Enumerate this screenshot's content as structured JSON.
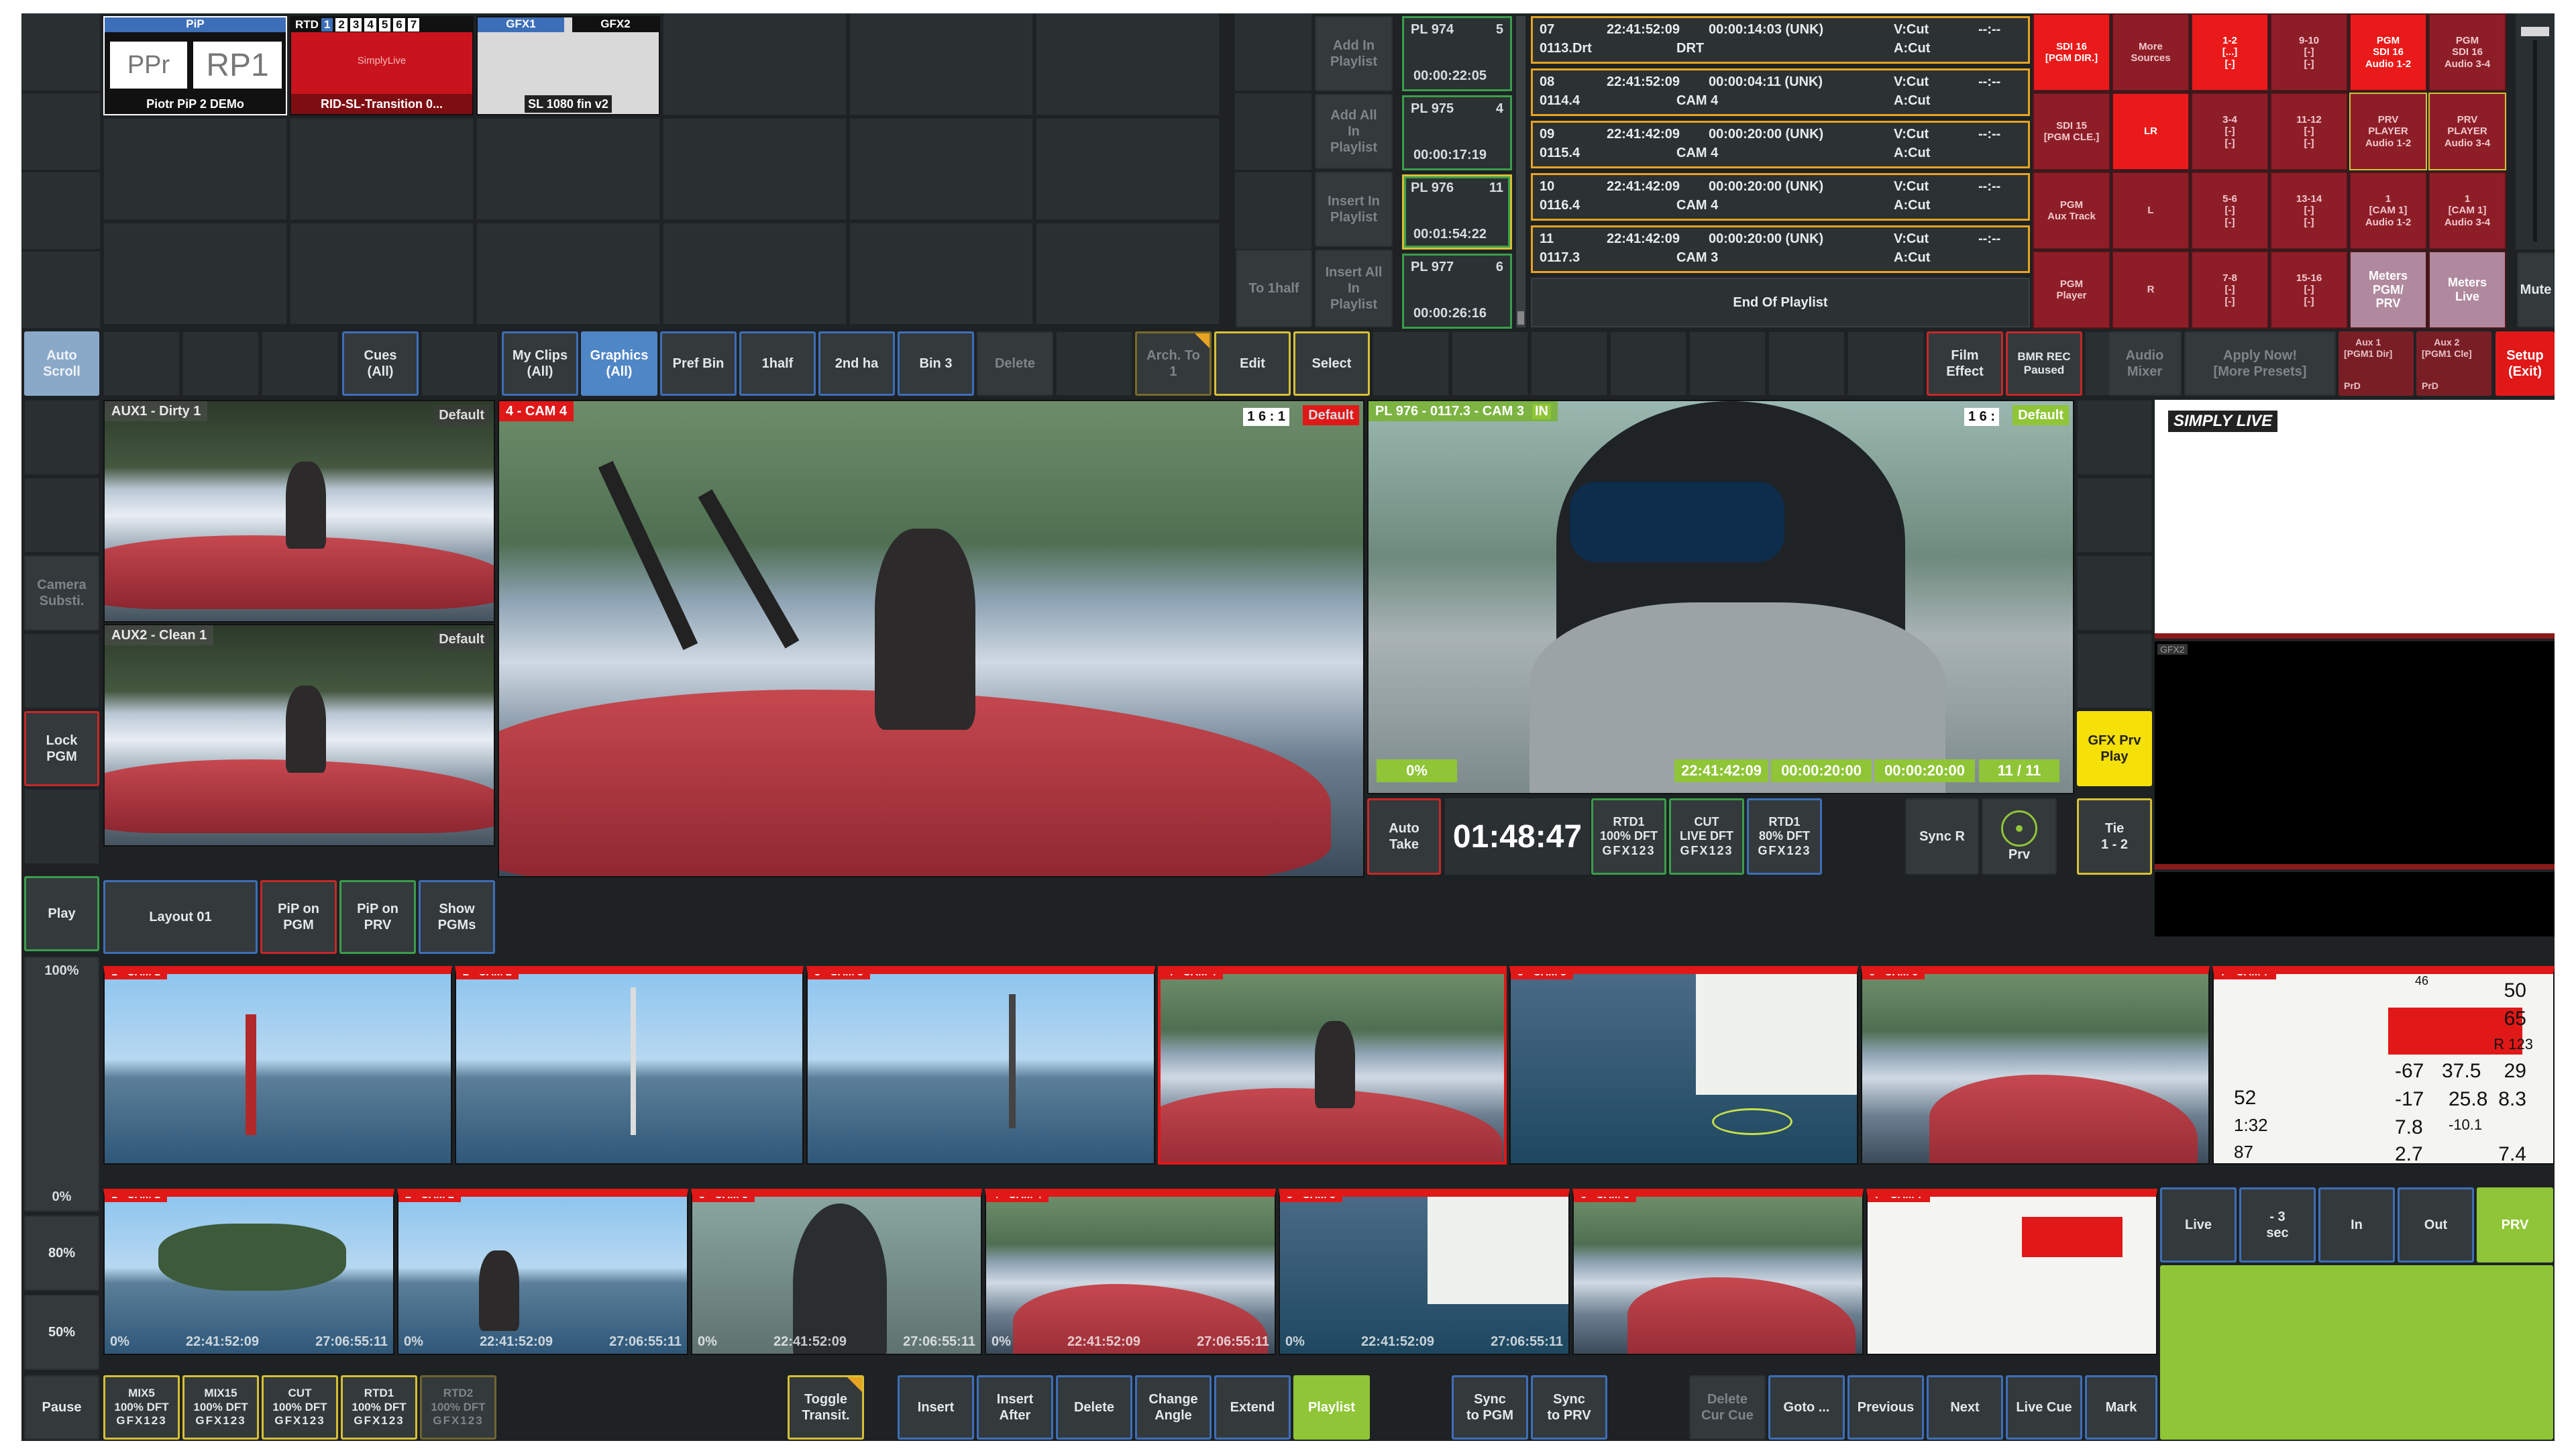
{
  "graphics_panel": {
    "pip": {
      "header": "PiP",
      "left": "PPr",
      "right": "RP1",
      "name": "Piotr PiP 2 DEMo"
    },
    "rtd": {
      "header": "RTD",
      "nums": [
        "1",
        "2",
        "3",
        "4",
        "5",
        "6",
        "7"
      ],
      "logo": "SimplyLive",
      "name": "RID-SL-Transition 0..."
    },
    "gfx": {
      "tab1": "GFX1",
      "tab2": "GFX2",
      "name": "SL 1080 fin v2"
    }
  },
  "playlist_actions": {
    "add_in": "Add In\nPlaylist",
    "add_all": "Add All\nIn\nPlaylist",
    "insert_in": "Insert In\nPlaylist",
    "to_1half": "To 1half",
    "insert_all": "Insert All\nIn\nPlaylist"
  },
  "playlists": [
    {
      "id": "PL 974",
      "count": "5",
      "dur": "00:00:22:05"
    },
    {
      "id": "PL 975",
      "count": "4",
      "dur": "00:00:17:19"
    },
    {
      "id": "PL 976",
      "count": "11",
      "dur": "00:01:54:22"
    },
    {
      "id": "PL 977",
      "count": "6",
      "dur": "00:00:26:16"
    }
  ],
  "playlist_entries": [
    {
      "num": "07",
      "clip": "0113.Drt",
      "tc": "22:41:52:09",
      "dur": "00:00:14:03 (UNK)",
      "src": "DRT",
      "v": "V:Cut",
      "a": "A:Cut",
      "x": "--:--"
    },
    {
      "num": "08",
      "clip": "0114.4",
      "tc": "22:41:52:09",
      "dur": "00:00:04:11 (UNK)",
      "src": "CAM 4",
      "v": "V:Cut",
      "a": "A:Cut",
      "x": "--:--"
    },
    {
      "num": "09",
      "clip": "0115.4",
      "tc": "22:41:42:09",
      "dur": "00:00:20:00 (UNK)",
      "src": "CAM 4",
      "v": "V:Cut",
      "a": "A:Cut",
      "x": "--:--"
    },
    {
      "num": "10",
      "clip": "0116.4",
      "tc": "22:41:42:09",
      "dur": "00:00:20:00 (UNK)",
      "src": "CAM 4",
      "v": "V:Cut",
      "a": "A:Cut",
      "x": "--:--"
    },
    {
      "num": "11",
      "clip": "0117.3",
      "tc": "22:41:42:09",
      "dur": "00:00:20:00 (UNK)",
      "src": "CAM 3",
      "v": "V:Cut",
      "a": "A:Cut",
      "x": "--:--"
    }
  ],
  "end_of_playlist": "End Of Playlist",
  "audio_grid": [
    [
      "SDI 16\n[PGM DIR.]",
      "More\nSources",
      "1-2\n[...]\n[-]",
      "9-10\n[-]\n[-]",
      "PGM\nSDI 16\nAudio 1-2",
      "PGM\nSDI 16\nAudio 3-4"
    ],
    [
      "SDI 15\n[PGM CLE.]",
      "LR",
      "3-4\n[-]\n[-]",
      "11-12\n[-]\n[-]",
      "PRV\nPLAYER\nAudio 1-2",
      "PRV\nPLAYER\nAudio 3-4"
    ],
    [
      "PGM\nAux Track",
      "L",
      "5-6\n[-]\n[-]",
      "13-14\n[-]\n[-]",
      "1\n[CAM 1]\nAudio 1-2",
      "1\n[CAM 1]\nAudio 3-4"
    ],
    [
      "PGM\nPlayer",
      "R",
      "7-8\n[-]\n[-]",
      "15-16\n[-]\n[-]",
      "Meters\nPGM/\nPRV",
      "Meters\nLive"
    ]
  ],
  "mute": "Mute",
  "toolbar": {
    "auto_scroll": "Auto\nScroll",
    "cues": "Cues\n(All)",
    "my_clips": "My Clips\n(All)",
    "graphics": "Graphics\n(All)",
    "pref_bin": "Pref Bin",
    "first_half": "1half",
    "second_half": "2nd ha",
    "bin3": "Bin 3",
    "delete": "Delete",
    "arch_to": "Arch. To\n1",
    "edit": "Edit",
    "select": "Select",
    "film_effect": "Film\nEffect",
    "bmr_rec": "BMR REC\nPaused",
    "audio_mixer": "Audio\nMixer",
    "apply_now": "Apply Now!\n[More Presets]",
    "aux1": "Aux 1\n[PGM1 Dir]",
    "aux1_sub": "PrD",
    "aux2": "Aux 2\n[PGM1 Cle]",
    "aux2_sub": "PrD",
    "setup": "Setup\n(Exit)"
  },
  "left_column": {
    "camera_subst": "Camera\nSubsti.",
    "lock_pgm": "Lock\nPGM",
    "play": "Play",
    "pct_100": "100%",
    "pct_0": "0%",
    "pct_80": "80%",
    "pct_50": "50%",
    "pause": "Pause"
  },
  "monitors": {
    "aux1": {
      "label": "AUX1 - Dirty 1",
      "preset": "Default"
    },
    "aux2": {
      "label": "AUX2 - Clean 1",
      "preset": "Default"
    },
    "pgm": {
      "label": "4 - CAM 4",
      "ratio": "1 6 : 1",
      "preset": "Default"
    },
    "prv": {
      "label": "PL 976 - 0117.3 - CAM 3",
      "in": "IN",
      "ratio": "1 6 :",
      "preset": "Default",
      "pct": "0%",
      "tc1": "22:41:42:09",
      "tc2": "00:00:20:00",
      "tc3": "00:00:20:00",
      "pos": "11 / 11"
    },
    "gfx2": "GFX2",
    "simplylive": "SIMPLY LIVE"
  },
  "gfx_prv_play": "GFX Prv\nPlay",
  "transport": {
    "auto_take": "Auto\nTake",
    "timer": "01:48:47",
    "rtd1": "RTD1\n100% DFT",
    "cut": "CUT\nLIVE DFT",
    "rtd1b": "RTD1\n80% DFT",
    "gfx_sub": "GFX123",
    "sync_r": "Sync R",
    "prv": "Prv",
    "tie": "Tie\n1 - 2"
  },
  "layout_row": {
    "layout": "Layout 01",
    "pip_pgm": "PiP on\nPGM",
    "pip_prv": "PiP on\nPRV",
    "show_pgms": "Show\nPGMs"
  },
  "cams_top": [
    "1 - CAM 1",
    "2 - CAM 2",
    "3 - CAM 3",
    "4 - CAM 4",
    "5 - CAM 5",
    "6 - CAM 6",
    "7 - CAM 7"
  ],
  "cams_bottom": [
    "1 - CAM 1",
    "2 - CAM 2",
    "3 - CAM 3",
    "4 - CAM 4",
    "5 - CAM 5",
    "6 - CAM 6",
    "7 - CAM 7"
  ],
  "thumb_caption": {
    "pct": "0%",
    "tc": "22:41:52:09",
    "tc2": "27:06:55:11"
  },
  "side_actions": {
    "live": "Live",
    "minus3": "- 3\nsec",
    "in": "In",
    "out": "Out",
    "prv": "PRV"
  },
  "bottom_bar": {
    "mix5": "MIX5\n100% DFT",
    "mix15": "MIX15\n100% DFT",
    "cut": "CUT\n100% DFT",
    "rtd1": "RTD1\n100% DFT",
    "rtd2": "RTD2\n100% DFT",
    "gfx_sub": "GFX123",
    "toggle": "Toggle\nTransit.",
    "insert": "Insert",
    "insert_after": "Insert\nAfter",
    "delete": "Delete",
    "change_angle": "Change\nAngle",
    "extend": "Extend",
    "playlist": "Playlist",
    "sync_pgm": "Sync\nto PGM",
    "sync_prv": "Sync\nto PRV",
    "delete_cue": "Delete\nCur Cue",
    "goto": "Goto ...",
    "previous": "Previous",
    "next": "Next",
    "live_cue": "Live Cue",
    "mark": "Mark"
  },
  "telemetry": {
    "v1": "50",
    "v2": "65",
    "v3": "R 123",
    "v4": "-67",
    "v5": "37.5",
    "v6": "29",
    "v7": "52",
    "v8": "-17",
    "v9": "25.8",
    "v10": "8.3",
    "v11": "1:32",
    "v12": "7.8",
    "v13": "-10.1",
    "v14": "2.7",
    "v15": "7.4",
    "v16": "46",
    "v17": "87"
  }
}
